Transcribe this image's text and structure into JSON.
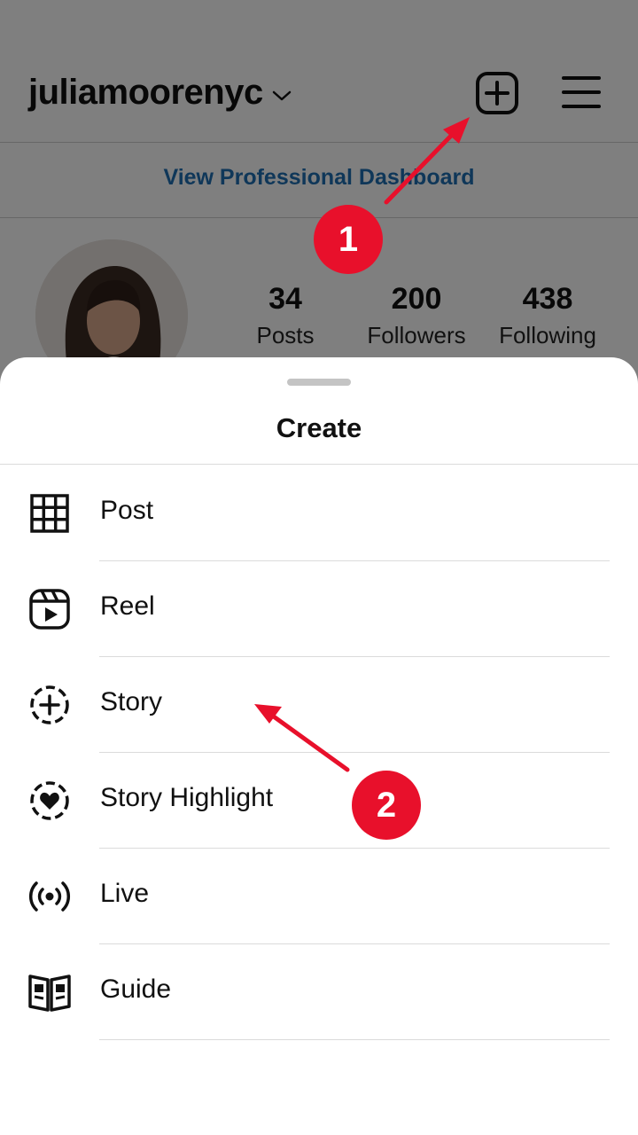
{
  "profile": {
    "username": "juliamoorenyc",
    "dashboard_link": "View Professional Dashboard",
    "stats": [
      {
        "value": "34",
        "label": "Posts"
      },
      {
        "value": "200",
        "label": "Followers"
      },
      {
        "value": "438",
        "label": "Following"
      }
    ]
  },
  "sheet": {
    "title": "Create",
    "items": [
      {
        "label": "Post",
        "icon": "grid-icon"
      },
      {
        "label": "Reel",
        "icon": "reel-icon"
      },
      {
        "label": "Story",
        "icon": "story-add-icon"
      },
      {
        "label": "Story Highlight",
        "icon": "highlight-heart-icon"
      },
      {
        "label": "Live",
        "icon": "live-broadcast-icon"
      },
      {
        "label": "Guide",
        "icon": "guide-book-icon"
      }
    ]
  },
  "annotations": {
    "step1": "1",
    "step2": "2",
    "color": "#e8102b"
  }
}
